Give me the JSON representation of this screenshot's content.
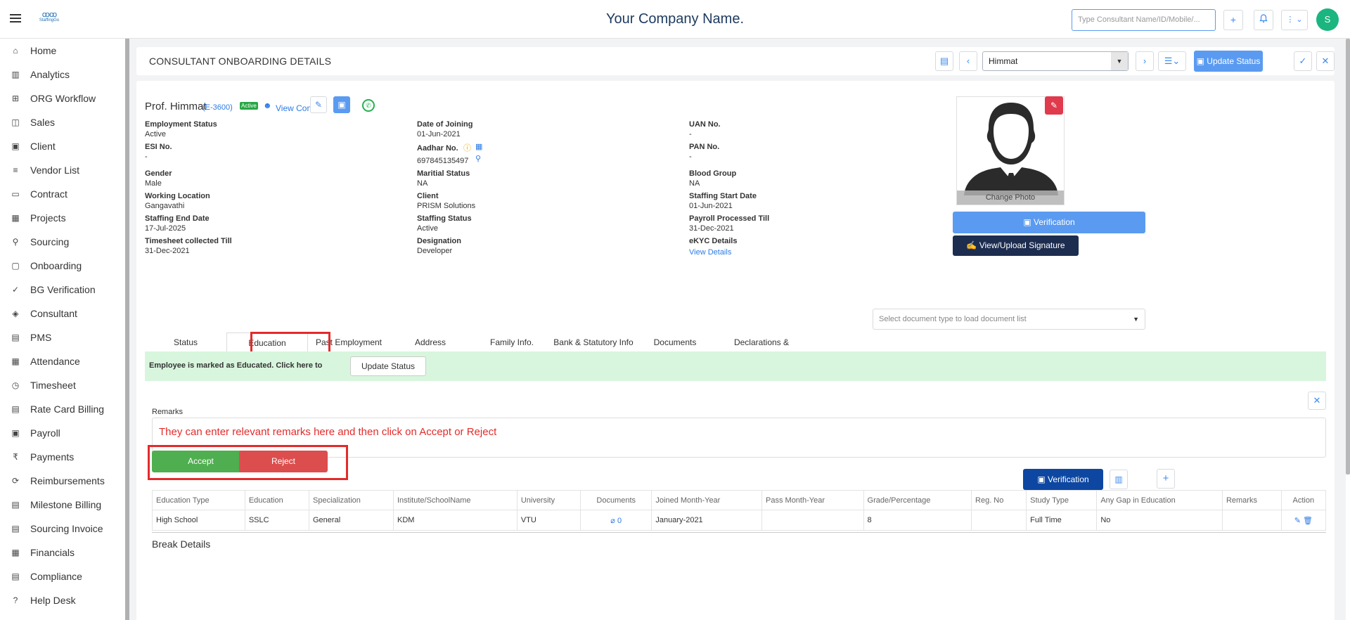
{
  "topbar": {
    "logo_text": "StaffingGo",
    "company_name": "Your Company Name.",
    "search_placeholder": "Type Consultant Name/ID/Mobile/...",
    "avatar_initial": "S"
  },
  "sidebar": {
    "items": [
      {
        "label": "Home",
        "icon": "home-icon"
      },
      {
        "label": "Analytics",
        "icon": "analytics-icon"
      },
      {
        "label": "ORG Workflow",
        "icon": "workflow-icon"
      },
      {
        "label": "Sales",
        "icon": "sales-icon"
      },
      {
        "label": "Client",
        "icon": "client-icon"
      },
      {
        "label": "Vendor List",
        "icon": "vendor-list-icon"
      },
      {
        "label": "Contract",
        "icon": "contract-icon"
      },
      {
        "label": "Projects",
        "icon": "projects-icon"
      },
      {
        "label": "Sourcing",
        "icon": "sourcing-icon"
      },
      {
        "label": "Onboarding",
        "icon": "onboarding-icon"
      },
      {
        "label": "BG Verification",
        "icon": "bg-verification-icon"
      },
      {
        "label": "Consultant",
        "icon": "consultant-icon"
      },
      {
        "label": "PMS",
        "icon": "pms-icon"
      },
      {
        "label": "Attendance",
        "icon": "attendance-icon"
      },
      {
        "label": "Timesheet",
        "icon": "timesheet-icon"
      },
      {
        "label": "Rate Card Billing",
        "icon": "rate-card-icon"
      },
      {
        "label": "Payroll",
        "icon": "payroll-icon"
      },
      {
        "label": "Payments",
        "icon": "rupee-icon"
      },
      {
        "label": "Reimbursements",
        "icon": "reimbursements-icon"
      },
      {
        "label": "Milestone Billing",
        "icon": "milestone-icon"
      },
      {
        "label": "Sourcing Invoice",
        "icon": "invoice-icon"
      },
      {
        "label": "Financials",
        "icon": "financials-icon"
      },
      {
        "label": "Compliance",
        "icon": "compliance-icon"
      },
      {
        "label": "Help Desk",
        "icon": "help-icon"
      }
    ]
  },
  "header": {
    "title": "CONSULTANT ONBOARDING DETAILS",
    "consultant_selected": "Himmat",
    "update_status_label": "Update Status"
  },
  "profile": {
    "name": "Prof. Himmat",
    "emp_id": "(E-3600)",
    "status_badge": "Active",
    "view_contact": "View Contact",
    "change_photo": "Change Photo",
    "verification_label": "Verification",
    "signature_label": "View/Upload Signature",
    "fields": {
      "employment_status": {
        "label": "Employment Status",
        "value": "Active"
      },
      "date_of_joining": {
        "label": "Date of Joining",
        "value": "01-Jun-2021"
      },
      "uan_no": {
        "label": "UAN No.",
        "value": "-"
      },
      "esi_no": {
        "label": "ESI No.",
        "value": "-"
      },
      "aadhar_no": {
        "label": "Aadhar No.",
        "value": "697845135497"
      },
      "pan_no": {
        "label": "PAN No.",
        "value": "-"
      },
      "gender": {
        "label": "Gender",
        "value": "Male"
      },
      "marital_status": {
        "label": "Maritial Status",
        "value": "NA"
      },
      "blood_group": {
        "label": "Blood Group",
        "value": "NA"
      },
      "working_location": {
        "label": "Working Location",
        "value": "Gangavathi"
      },
      "client": {
        "label": "Client",
        "value": "PRISM Solutions"
      },
      "staffing_start_date": {
        "label": "Staffing Start Date",
        "value": "01-Jun-2021"
      },
      "staffing_end_date": {
        "label": "Staffing End Date",
        "value": "17-Jul-2025"
      },
      "staffing_status": {
        "label": "Staffing Status",
        "value": "Active"
      },
      "payroll_processed_till": {
        "label": "Payroll Processed Till",
        "value": "31-Dec-2021"
      },
      "timesheet_collected_till": {
        "label": "Timesheet collected Till",
        "value": "31-Dec-2021"
      },
      "designation": {
        "label": "Designation",
        "value": "Developer"
      },
      "ekyc_details": {
        "label": "eKYC Details",
        "value": "View Details"
      }
    }
  },
  "documents": {
    "select_placeholder": "Select document type to load document list"
  },
  "tabs": [
    {
      "label": "Status"
    },
    {
      "label": "Education"
    },
    {
      "label": "Past Employment"
    },
    {
      "label": "Address"
    },
    {
      "label": "Family Info."
    },
    {
      "label": "Bank & Statutory Info"
    },
    {
      "label": "Documents"
    },
    {
      "label": "Declarations & References"
    }
  ],
  "education": {
    "banner_text": "Employee is marked as Educated.   Click here to",
    "banner_button": "Update Status",
    "remarks_label": "Remarks",
    "remarks_text": "They can enter relevant remarks here and then click on Accept or Reject",
    "accept_label": "Accept",
    "reject_label": "Reject",
    "verification_label": "Verification",
    "columns": [
      "Education Type",
      "Education",
      "Specialization",
      "Institute/SchoolName",
      "University",
      "Documents",
      "Joined Month-Year",
      "Pass Month-Year",
      "Grade/Percentage",
      "Reg. No",
      "Study Type",
      "Any Gap in Education",
      "Remarks",
      "Action"
    ],
    "rows": [
      {
        "education_type": "High School",
        "education": "SSLC",
        "specialization": "General",
        "institute": "KDM",
        "university": "VTU",
        "documents": "0",
        "joined": "January-2021",
        "passed": "",
        "grade": "8",
        "reg_no": "",
        "study_type": "Full Time",
        "gap": "No",
        "remarks": ""
      }
    ],
    "break_details_title": "Break Details"
  },
  "colors": {
    "accent": "#5a9bf1",
    "dark_blue": "#0d47a1",
    "navy": "#1c2d4f",
    "success": "#4fae4f",
    "danger": "#dc4d4d",
    "annotation_red": "#e32b2b"
  }
}
